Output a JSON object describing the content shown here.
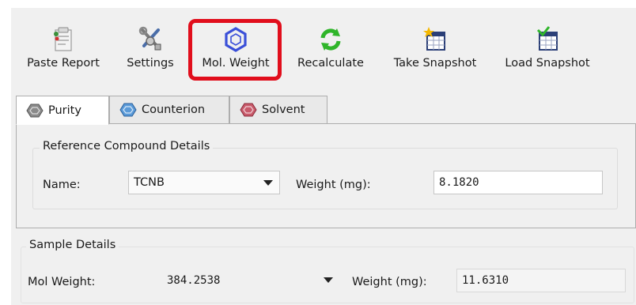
{
  "toolbar": {
    "buttons": [
      {
        "label": "Paste Report",
        "icon": "paste-report-icon"
      },
      {
        "label": "Settings",
        "icon": "settings-tools-icon"
      },
      {
        "label": "Mol. Weight",
        "icon": "hexagon-molecule-icon",
        "highlighted": true
      },
      {
        "label": "Recalculate",
        "icon": "green-refresh-icon"
      },
      {
        "label": "Take Snapshot",
        "icon": "take-snapshot-icon"
      },
      {
        "label": "Load Snapshot",
        "icon": "load-snapshot-icon"
      }
    ]
  },
  "tabs": [
    {
      "label": "Purity",
      "icon": "gray-hexagon-icon",
      "active": true
    },
    {
      "label": "Counterion",
      "icon": "blue-hexagon-icon",
      "active": false
    },
    {
      "label": "Solvent",
      "icon": "red-hexagon-icon",
      "active": false
    }
  ],
  "reference": {
    "group_title": "Reference Compound Details",
    "name_label": "Name:",
    "name_value": "TCNB",
    "weight_label": "Weight (mg):",
    "weight_value": "8.1820"
  },
  "sample": {
    "group_title": "Sample Details",
    "mol_weight_label": "Mol Weight:",
    "mol_weight_value": "384.2538",
    "weight_label": "Weight (mg):",
    "weight_value": "11.6310"
  },
  "colors": {
    "highlight": "#e10e1c",
    "window_bg": "#f0f0f0",
    "hexagon_blue": "#3a4fd8",
    "refresh_green": "#2fb52a"
  }
}
